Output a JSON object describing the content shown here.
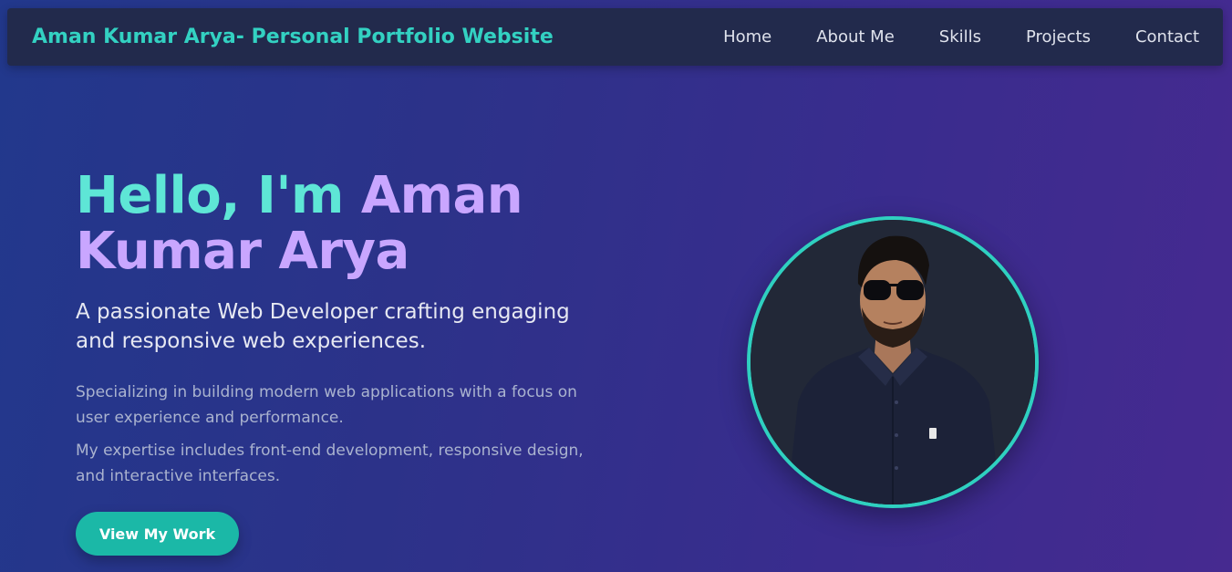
{
  "header": {
    "brand": "Aman Kumar Arya- Personal Portfolio Website",
    "nav": [
      "Home",
      "About Me",
      "Skills",
      "Projects",
      "Contact"
    ]
  },
  "hero": {
    "title_hello": "Hello, I'm",
    "title_name_line1": "Aman",
    "title_name_line2": "Kumar Arya",
    "tagline": "A passionate Web Developer crafting engaging and responsive web experiences.",
    "desc1": "Specializing in building modern web applications with a focus on user experience and performance.",
    "desc2": "My expertise includes front-end development, responsive design, and interactive interfaces.",
    "cta_label": "View My Work"
  },
  "colors": {
    "accent_teal": "#33d1c2",
    "accent_purple": "#c9a6ff",
    "nav_bg": "#222a4c",
    "button_bg": "#1bb8a7"
  },
  "icons": {
    "profile_photo": "profile-photo"
  }
}
